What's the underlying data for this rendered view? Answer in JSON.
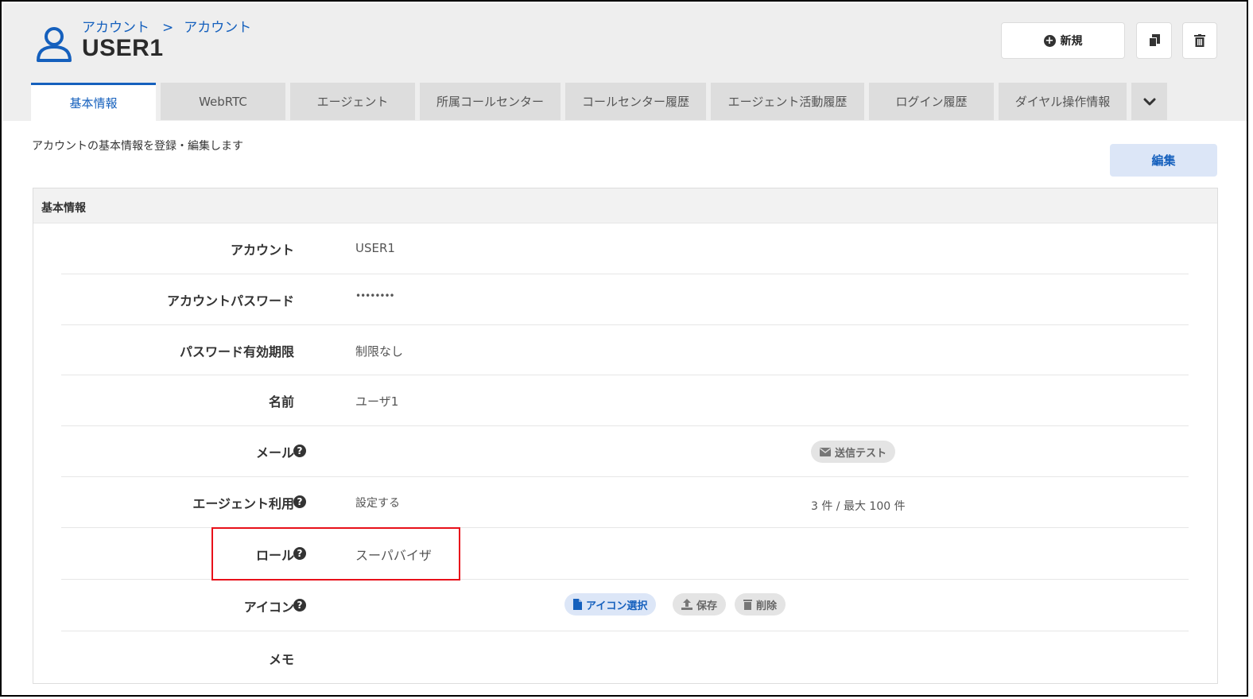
{
  "header": {
    "breadcrumb": [
      "アカウント",
      "アカウント"
    ],
    "breadcrumb_separator": ">",
    "title": "USER1",
    "new_button_label": "新規",
    "icons": [
      "user-icon",
      "plus-circle-icon",
      "copy-icon",
      "trash-icon"
    ]
  },
  "tabs": [
    {
      "label": "基本情報",
      "active": true
    },
    {
      "label": "WebRTC"
    },
    {
      "label": "エージェント"
    },
    {
      "label": "所属コールセンター"
    },
    {
      "label": "コールセンター履歴"
    },
    {
      "label": "エージェント活動履歴"
    },
    {
      "label": "ログイン履歴"
    },
    {
      "label": "ダイヤル操作情報"
    }
  ],
  "description": "アカウントの基本情報を登録・編集します",
  "edit_button_label": "編集",
  "panel": {
    "title": "基本情報",
    "rows": [
      {
        "label": "アカウント",
        "value": "USER1"
      },
      {
        "label": "アカウントパスワード",
        "value": "••••••••"
      },
      {
        "label": "パスワード有効期限",
        "value": "制限なし"
      },
      {
        "label": "名前",
        "value": "ユーザ1"
      },
      {
        "label": "メール",
        "value": "",
        "action": "送信テスト"
      },
      {
        "label": "エージェント利用",
        "value": "設定する",
        "extra": "3 件 / 最大 100 件"
      },
      {
        "label": "ロール",
        "value": "スーパバイザ"
      },
      {
        "label": "アイコン",
        "value": "",
        "actions": [
          "アイコン選択",
          "保存",
          "削除"
        ]
      },
      {
        "label": "メモ",
        "value": ""
      }
    ]
  },
  "colors": {
    "accent": "#1560bd",
    "header_bg": "#eeeeee",
    "tab_bg": "#dddddd",
    "edit_bg": "#dce6f7",
    "highlight": "#e8101a"
  }
}
